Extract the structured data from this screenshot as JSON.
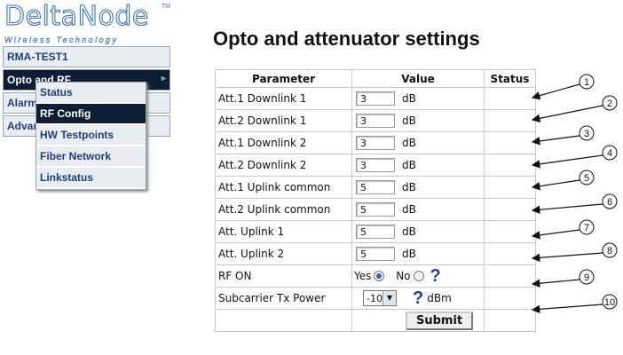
{
  "logo": {
    "name": "DeltaNode",
    "tagline": "Wireless Technology",
    "tm": "TM"
  },
  "nav": {
    "items": [
      {
        "label": "RMA-TEST1"
      },
      {
        "label": "Opto and RF"
      },
      {
        "label": "Alarms"
      },
      {
        "label": "Advanced"
      }
    ],
    "submenu": [
      {
        "label": "Status",
        "active": false
      },
      {
        "label": "RF Config",
        "active": true
      },
      {
        "label": "HW Testpoints",
        "active": false
      },
      {
        "label": "Fiber Network",
        "active": false
      },
      {
        "label": "Linkstatus",
        "active": false
      }
    ]
  },
  "page": {
    "title": "Opto and attenuator settings"
  },
  "table": {
    "headers": {
      "parameter": "Parameter",
      "value": "Value",
      "status": "Status"
    },
    "rows": [
      {
        "param": "Att.1 Downlink 1",
        "value": "3",
        "unit": "dB"
      },
      {
        "param": "Att.2 Downlink 1",
        "value": "3",
        "unit": "dB"
      },
      {
        "param": "Att.1 Downlink 2",
        "value": "3",
        "unit": "dB"
      },
      {
        "param": "Att.2 Downlink 2",
        "value": "3",
        "unit": "dB"
      },
      {
        "param": "Att.1 Uplink common",
        "value": "5",
        "unit": "dB"
      },
      {
        "param": "Att.2 Uplink common",
        "value": "5",
        "unit": "dB"
      },
      {
        "param": "Att. Uplink 1",
        "value": "5",
        "unit": "dB"
      },
      {
        "param": "Att. Uplink 2",
        "value": "5",
        "unit": "dB"
      }
    ],
    "rf_on": {
      "param": "RF ON",
      "yes": "Yes",
      "no": "No",
      "selected": "Yes",
      "help": "?"
    },
    "subcarrier": {
      "param": "Subcarrier Tx Power",
      "value": "-10",
      "unit": "dBm",
      "help": "?"
    },
    "submit_label": "Submit"
  },
  "callouts": [
    "1",
    "2",
    "3",
    "4",
    "5",
    "6",
    "7",
    "8",
    "9",
    "10"
  ]
}
